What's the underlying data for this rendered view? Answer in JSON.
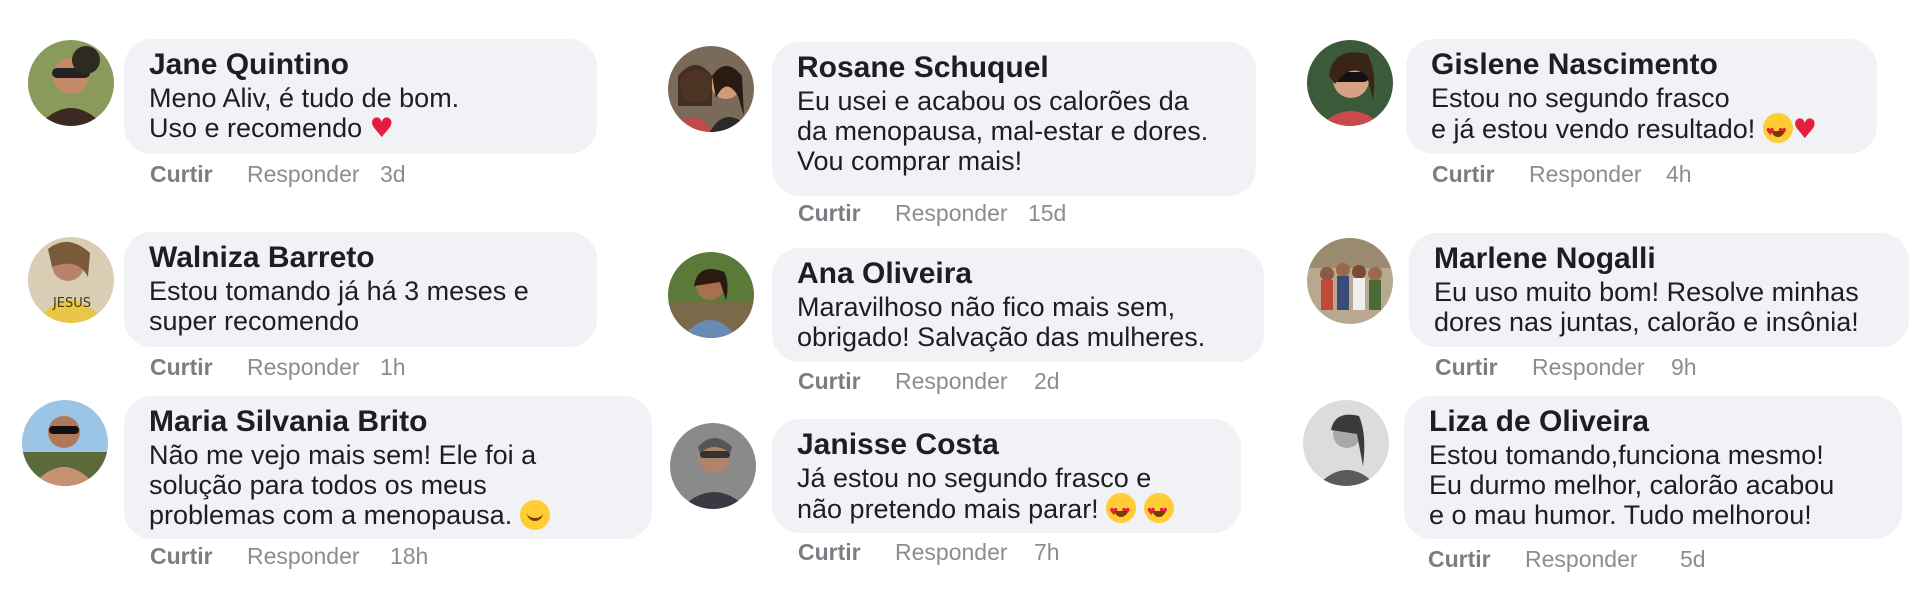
{
  "comments": [
    {
      "author": "Jane Quintino",
      "lines": [
        "Meno Aliv, é tudo de bom.",
        "Uso e recomendo"
      ],
      "emoji": "heart",
      "like": "Curtir",
      "reply": "Responder",
      "time": "3d"
    },
    {
      "author": "Rosane Schuquel",
      "lines": [
        "Eu usei e acabou os calorões da",
        "da menopausa, mal-estar e dores.",
        "Vou comprar mais!"
      ],
      "like": "Curtir",
      "reply": "Responder",
      "time": "15d"
    },
    {
      "author": "Gislene Nascimento",
      "lines": [
        "Estou no segundo frasco",
        "e já estou vendo resultado!"
      ],
      "emoji": "heart-eyes-heart",
      "like": "Curtir",
      "reply": "Responder",
      "time": "4h"
    },
    {
      "author": "Walniza Barreto",
      "lines": [
        "Estou tomando já há 3 meses e",
        "super recomendo"
      ],
      "like": "Curtir",
      "reply": "Responder",
      "time": "1h"
    },
    {
      "author": "Ana Oliveira",
      "lines": [
        "Maravilhoso não fico mais sem,",
        "obrigado! Salvação das mulheres."
      ],
      "like": "Curtir",
      "reply": "Responder",
      "time": "2d"
    },
    {
      "author": "Marlene Nogalli",
      "lines": [
        "Eu uso muito bom! Resolve minhas",
        "dores nas juntas, calorão e insônia!"
      ],
      "like": "Curtir",
      "reply": "Responder",
      "time": "9h"
    },
    {
      "author": "Maria Silvania Brito",
      "lines": [
        "Não me vejo mais sem! Ele foi a",
        "solução para todos os meus",
        "problemas com a menopausa."
      ],
      "emoji": "smile",
      "like": "Curtir",
      "reply": "Responder",
      "time": "18h"
    },
    {
      "author": "Janisse Costa",
      "lines": [
        "Já estou no segundo frasco e",
        "não pretendo mais parar!"
      ],
      "emoji": "heart-eyes-2",
      "like": "Curtir",
      "reply": "Responder",
      "time": "7h"
    },
    {
      "author": "Liza de Oliveira",
      "lines": [
        "Estou tomando,funciona mesmo!",
        "Eu durmo melhor, calorão acabou",
        "e o mau humor. Tudo melhorou!"
      ],
      "like": "Curtir",
      "reply": "Responder",
      "time": "5d"
    }
  ],
  "colors": {
    "bubble": "#f0f2f5",
    "meta": "#8a8d91",
    "heart": "#e41e3f"
  }
}
